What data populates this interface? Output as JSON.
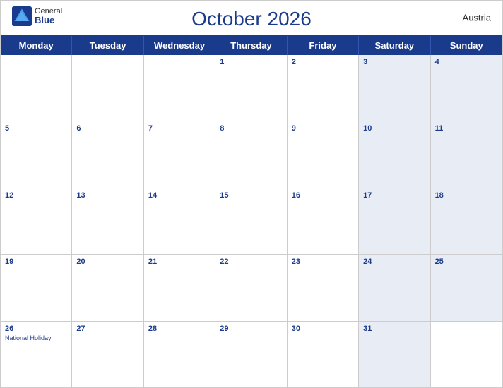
{
  "header": {
    "logo_general": "General",
    "logo_blue": "Blue",
    "title": "October 2026",
    "country": "Austria"
  },
  "days_of_week": [
    "Monday",
    "Tuesday",
    "Wednesday",
    "Thursday",
    "Friday",
    "Saturday",
    "Sunday"
  ],
  "weeks": [
    [
      {
        "date": "",
        "weekend": false,
        "empty": true
      },
      {
        "date": "",
        "weekend": false,
        "empty": true
      },
      {
        "date": "",
        "weekend": false,
        "empty": true
      },
      {
        "date": "1",
        "weekend": false
      },
      {
        "date": "2",
        "weekend": false
      },
      {
        "date": "3",
        "weekend": true
      },
      {
        "date": "4",
        "weekend": true
      }
    ],
    [
      {
        "date": "5",
        "weekend": false
      },
      {
        "date": "6",
        "weekend": false
      },
      {
        "date": "7",
        "weekend": false
      },
      {
        "date": "8",
        "weekend": false
      },
      {
        "date": "9",
        "weekend": false
      },
      {
        "date": "10",
        "weekend": true
      },
      {
        "date": "11",
        "weekend": true
      }
    ],
    [
      {
        "date": "12",
        "weekend": false
      },
      {
        "date": "13",
        "weekend": false
      },
      {
        "date": "14",
        "weekend": false
      },
      {
        "date": "15",
        "weekend": false
      },
      {
        "date": "16",
        "weekend": false
      },
      {
        "date": "17",
        "weekend": true
      },
      {
        "date": "18",
        "weekend": true
      }
    ],
    [
      {
        "date": "19",
        "weekend": false
      },
      {
        "date": "20",
        "weekend": false
      },
      {
        "date": "21",
        "weekend": false
      },
      {
        "date": "22",
        "weekend": false
      },
      {
        "date": "23",
        "weekend": false
      },
      {
        "date": "24",
        "weekend": true
      },
      {
        "date": "25",
        "weekend": true
      }
    ],
    [
      {
        "date": "26",
        "weekend": false,
        "holiday": "National Holiday"
      },
      {
        "date": "27",
        "weekend": false
      },
      {
        "date": "28",
        "weekend": false
      },
      {
        "date": "29",
        "weekend": false
      },
      {
        "date": "30",
        "weekend": false
      },
      {
        "date": "31",
        "weekend": true
      },
      {
        "date": "",
        "weekend": true,
        "empty": true
      }
    ]
  ]
}
